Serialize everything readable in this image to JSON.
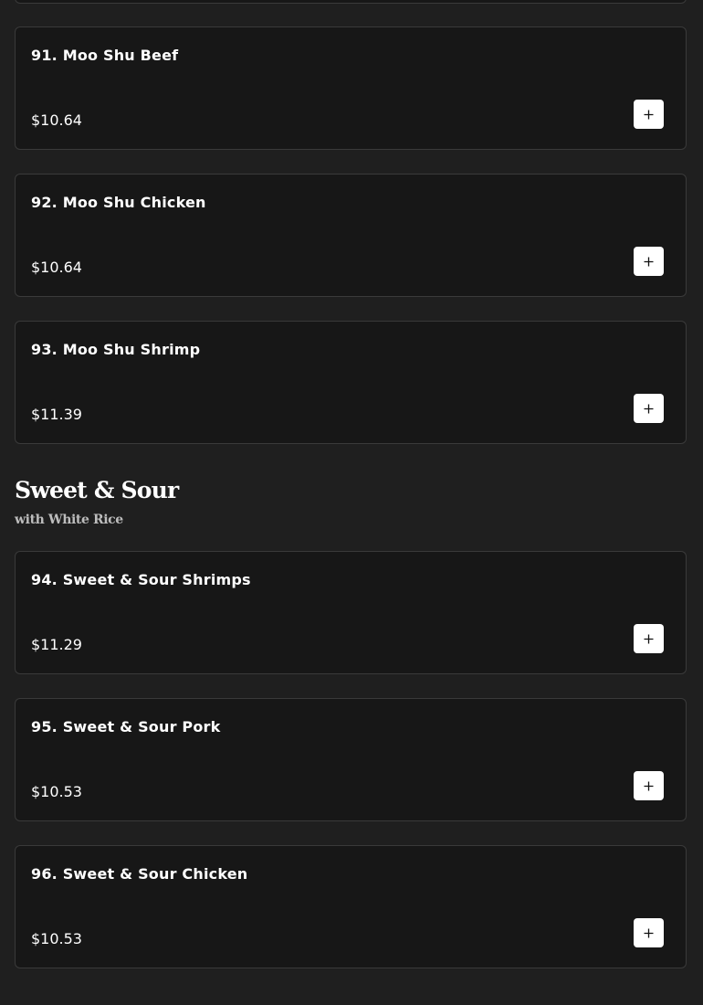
{
  "sections": [
    {
      "items": [
        {
          "name": "91. Moo Shu Beef",
          "price": "$10.64"
        },
        {
          "name": "92. Moo Shu Chicken",
          "price": "$10.64"
        },
        {
          "name": "93. Moo Shu Shrimp",
          "price": "$11.39"
        }
      ]
    },
    {
      "title": "Sweet & Sour",
      "subtitle": "with White Rice",
      "items": [
        {
          "name": "94. Sweet & Sour Shrimps",
          "price": "$11.29"
        },
        {
          "name": "95. Sweet & Sour Pork",
          "price": "$10.53"
        },
        {
          "name": "96. Sweet & Sour Chicken",
          "price": "$10.53"
        }
      ]
    }
  ],
  "icons": {
    "add": "plus-icon"
  },
  "colors": {
    "background": "#1f1f1f",
    "card": "#171717",
    "card_border": "#3a3a3a",
    "button": "#ffffff",
    "text": "#ffffff",
    "subtitle": "#bdbdbd"
  }
}
